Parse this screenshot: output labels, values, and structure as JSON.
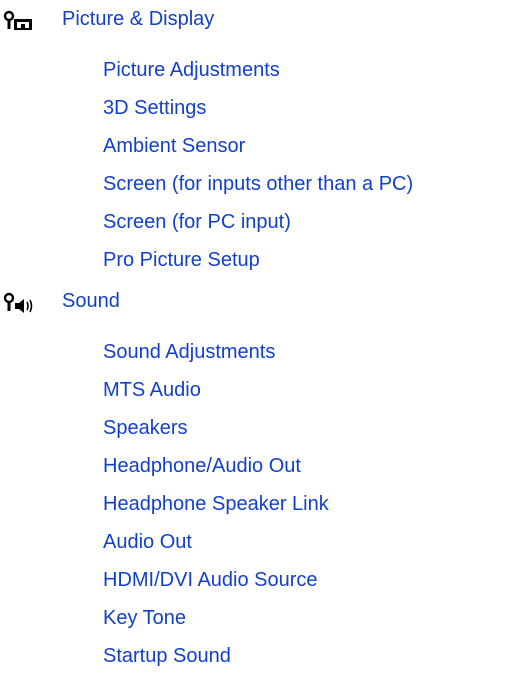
{
  "colors": {
    "link": "#1340c8",
    "icon": "#000000"
  },
  "sections": [
    {
      "icon": "picture-display-icon",
      "title": "Picture & Display",
      "items": [
        "Picture Adjustments",
        "3D Settings",
        "Ambient Sensor",
        "Screen (for inputs other than a PC)",
        "Screen (for PC input)",
        "Pro Picture Setup"
      ]
    },
    {
      "icon": "sound-icon",
      "title": "Sound",
      "items": [
        "Sound Adjustments",
        "MTS Audio",
        "Speakers",
        "Headphone/Audio Out",
        "Headphone Speaker Link",
        "Audio Out",
        "HDMI/DVI Audio Source",
        "Key Tone",
        "Startup Sound"
      ]
    }
  ]
}
